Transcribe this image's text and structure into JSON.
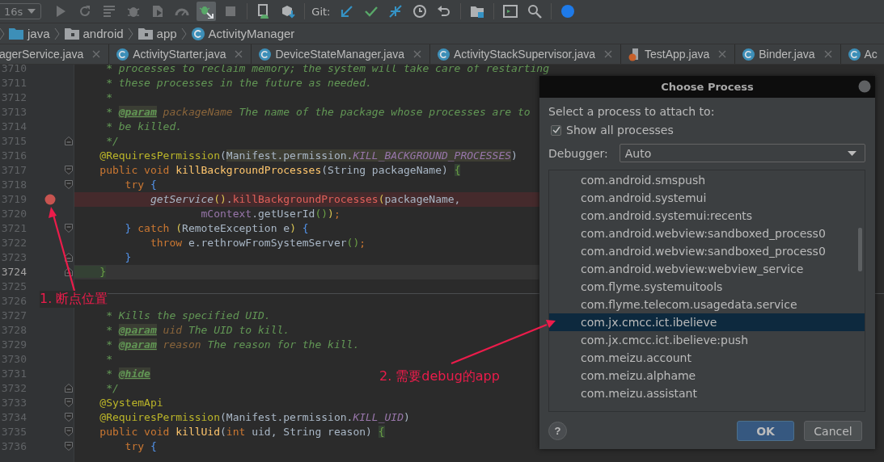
{
  "toolbar": {
    "config": "16s",
    "groups": [
      {
        "tools": [
          {
            "kind": "run",
            "disabled": true,
            "selected": false
          },
          {
            "kind": "rerun",
            "disabled": true,
            "selected": false
          },
          {
            "kind": "log",
            "disabled": true,
            "selected": false
          },
          {
            "kind": "debug",
            "disabled": true,
            "selected": false
          },
          {
            "kind": "coverage",
            "disabled": true,
            "selected": false
          },
          {
            "kind": "profile",
            "disabled": true,
            "selected": false
          },
          {
            "kind": "attach",
            "disabled": false,
            "selected": true
          },
          {
            "kind": "stop",
            "disabled": true,
            "selected": false
          }
        ]
      },
      {
        "tools": [
          {
            "kind": "device",
            "disabled": false,
            "selected": false
          },
          {
            "kind": "sdk",
            "disabled": false,
            "selected": false
          }
        ]
      },
      {
        "label": "Git:",
        "tools": [
          {
            "kind": "update",
            "disabled": false,
            "selected": false
          },
          {
            "kind": "commit",
            "disabled": false,
            "selected": false
          },
          {
            "kind": "compare",
            "disabled": false,
            "selected": false
          },
          {
            "kind": "history",
            "disabled": false,
            "selected": false
          },
          {
            "kind": "revert",
            "disabled": false,
            "selected": false
          }
        ]
      },
      {
        "tools": [
          {
            "kind": "folder",
            "disabled": false,
            "selected": false
          }
        ]
      },
      {
        "tools": [
          {
            "kind": "terminal",
            "disabled": false,
            "selected": false
          },
          {
            "kind": "search",
            "disabled": false,
            "selected": false
          }
        ]
      },
      {
        "tools": [
          {
            "kind": "sphere",
            "disabled": false,
            "selected": false
          }
        ]
      }
    ]
  },
  "breadcrumb": [
    {
      "kind": "source",
      "label": "java"
    },
    {
      "kind": "folder",
      "label": "android"
    },
    {
      "kind": "folder",
      "label": "app"
    },
    {
      "kind": "class",
      "label": "ActivityManager"
    }
  ],
  "tabs": [
    {
      "kind": "plain",
      "label": "agerService.java",
      "close": true
    },
    {
      "kind": "class",
      "label": "ActivityStarter.java",
      "close": true
    },
    {
      "kind": "class",
      "label": "DeviceStateManager.java",
      "close": true
    },
    {
      "kind": "class",
      "label": "ActivityStackSupervisor.java",
      "close": true
    },
    {
      "kind": "test",
      "label": "TestApp.java",
      "close": true
    },
    {
      "kind": "class",
      "label": "Binder.java",
      "close": true
    },
    {
      "kind": "class",
      "label": "Ac",
      "close": false
    }
  ],
  "lines": [
    {
      "number": "3710",
      "tokens": [
        {
          "kind": "comment",
          "text": "     * processes to reclaim memory; the system will take care of restarting"
        }
      ]
    },
    {
      "number": "3711",
      "tokens": [
        {
          "kind": "comment",
          "text": "     * these processes in the future as needed."
        }
      ]
    },
    {
      "number": "3712",
      "tokens": [
        {
          "kind": "comment",
          "text": "     *"
        }
      ]
    },
    {
      "number": "3713",
      "tokens": [
        {
          "kind": "comment",
          "text": "     * "
        },
        {
          "kind": "doctag",
          "text": "@param"
        },
        {
          "kind": "pname",
          "text": " packageName"
        },
        {
          "kind": "comment",
          "text": " The name of the package whose processes are to"
        }
      ]
    },
    {
      "number": "3714",
      "tokens": [
        {
          "kind": "comment",
          "text": "     * be killed."
        }
      ]
    },
    {
      "number": "3715",
      "fold_end": true,
      "tokens": [
        {
          "kind": "comment",
          "text": "     */"
        }
      ]
    },
    {
      "number": "3716",
      "tokens": [
        {
          "kind": "ann",
          "text": "    @RequiresPermission"
        },
        {
          "kind": "plain",
          "text": "("
        },
        {
          "kind": "hlplain",
          "text": "Manifest.permission."
        },
        {
          "kind": "hlconst",
          "text": "KILL_BACKGROUND_PROCESSES"
        },
        {
          "kind": "plain",
          "text": ")"
        }
      ]
    },
    {
      "number": "3717",
      "fold_start": true,
      "tokens": [
        {
          "kind": "kw",
          "text": "    public void "
        },
        {
          "kind": "fn",
          "text": "killBackgroundProcesses"
        },
        {
          "kind": "plain",
          "text": "(String packageName) "
        },
        {
          "kind": "gbrace",
          "text": "{"
        }
      ]
    },
    {
      "number": "3718",
      "fold_start": true,
      "tokens": [
        {
          "kind": "kw",
          "text": "        try "
        },
        {
          "kind": "bbrace",
          "text": "{"
        }
      ]
    },
    {
      "number": "3719",
      "breakpoint": true,
      "tokens": [
        {
          "kind": "static",
          "text": "            getService"
        },
        {
          "kind": "paren",
          "text": "()"
        },
        {
          "kind": "plain",
          "text": "."
        },
        {
          "kind": "call",
          "text": "killBackgroundProcesses"
        },
        {
          "kind": "paren",
          "text": "("
        },
        {
          "kind": "plain",
          "text": "packageName,"
        }
      ]
    },
    {
      "number": "3720",
      "tokens": [
        {
          "kind": "field",
          "text": "                    mContext"
        },
        {
          "kind": "plain",
          "text": ".getUserId"
        },
        {
          "kind": "gparen",
          "text": "()"
        },
        {
          "kind": "paren",
          "text": ")"
        },
        {
          "kind": "kw",
          "text": ";"
        }
      ]
    },
    {
      "number": "3721",
      "fold_start": true,
      "tokens": [
        {
          "kind": "bbrace",
          "text": "        }"
        },
        {
          "kind": "kw",
          "text": " catch "
        },
        {
          "kind": "paren",
          "text": "("
        },
        {
          "kind": "plain",
          "text": "RemoteException e"
        },
        {
          "kind": "paren",
          "text": ")"
        },
        {
          "kind": "bbrace",
          "text": " {"
        }
      ]
    },
    {
      "number": "3722",
      "tokens": [
        {
          "kind": "kw",
          "text": "            throw"
        },
        {
          "kind": "plain",
          "text": " e.rethrowFromSystemServer"
        },
        {
          "kind": "gparen",
          "text": "()"
        },
        {
          "kind": "kw",
          "text": ";"
        }
      ]
    },
    {
      "number": "3723",
      "fold_end": true,
      "tokens": [
        {
          "kind": "bbrace",
          "text": "        }"
        }
      ]
    },
    {
      "number": "3724",
      "fold_end": true,
      "current": true,
      "tokens": [
        {
          "kind": "gbrace",
          "text": "    }"
        }
      ]
    },
    {
      "number": "3725",
      "separator": true
    },
    {
      "number": "3726"
    },
    {
      "number": "3727",
      "tokens": [
        {
          "kind": "comment",
          "text": "     * Kills the specified UID."
        }
      ]
    },
    {
      "number": "3728",
      "tokens": [
        {
          "kind": "comment",
          "text": "     * "
        },
        {
          "kind": "doctag",
          "text": "@param"
        },
        {
          "kind": "pname",
          "text": " uid"
        },
        {
          "kind": "comment",
          "text": " The UID to kill."
        }
      ]
    },
    {
      "number": "3729",
      "tokens": [
        {
          "kind": "comment",
          "text": "     * "
        },
        {
          "kind": "doctag",
          "text": "@param"
        },
        {
          "kind": "pname",
          "text": " reason"
        },
        {
          "kind": "comment",
          "text": " The reason for the kill."
        }
      ]
    },
    {
      "number": "3730",
      "tokens": [
        {
          "kind": "comment",
          "text": "     *"
        }
      ]
    },
    {
      "number": "3731",
      "tokens": [
        {
          "kind": "comment",
          "text": "     * "
        },
        {
          "kind": "doctag",
          "text": "@hide"
        }
      ]
    },
    {
      "number": "3732",
      "fold_end": true,
      "tokens": [
        {
          "kind": "comment",
          "text": "     */"
        }
      ]
    },
    {
      "number": "3733",
      "fold_start": true,
      "tokens": [
        {
          "kind": "ann",
          "text": "    @SystemApi"
        }
      ]
    },
    {
      "number": "3734",
      "fold_start": true,
      "tokens": [
        {
          "kind": "ann",
          "text": "    @RequiresPermission"
        },
        {
          "kind": "plain",
          "text": "(Manifest.permission."
        },
        {
          "kind": "const",
          "text": "KILL_UID"
        },
        {
          "kind": "plain",
          "text": ")"
        }
      ]
    },
    {
      "number": "3735",
      "fold_start": true,
      "tokens": [
        {
          "kind": "kw",
          "text": "    public void "
        },
        {
          "kind": "fn",
          "text": "killUid"
        },
        {
          "kind": "plain",
          "text": "("
        },
        {
          "kind": "kw",
          "text": "int"
        },
        {
          "kind": "plain",
          "text": " uid, String reason) "
        },
        {
          "kind": "gbrace",
          "text": "{"
        }
      ]
    },
    {
      "number": "3736",
      "fold_start": true,
      "tokens": [
        {
          "kind": "kw",
          "text": "        try "
        },
        {
          "kind": "bbrace",
          "text": "{"
        }
      ]
    }
  ],
  "dialog": {
    "title": "Choose Process",
    "prompt": "Select a process to attach to:",
    "show_all": {
      "label": "Show all processes",
      "checked": true
    },
    "debugger": {
      "label": "Debugger:",
      "value": "Auto"
    },
    "processes": [
      {
        "name": "com.android.smspush",
        "selected": false
      },
      {
        "name": "com.android.systemui",
        "selected": false
      },
      {
        "name": "com.android.systemui:recents",
        "selected": false
      },
      {
        "name": "com.android.webview:sandboxed_process0",
        "selected": false
      },
      {
        "name": "com.android.webview:sandboxed_process0",
        "selected": false
      },
      {
        "name": "com.android.webview:webview_service",
        "selected": false
      },
      {
        "name": "com.flyme.systemuitools",
        "selected": false
      },
      {
        "name": "com.flyme.telecom.usagedata.service",
        "selected": false
      },
      {
        "name": "com.jx.cmcc.ict.ibelieve",
        "selected": true
      },
      {
        "name": "com.jx.cmcc.ict.ibelieve:push",
        "selected": false
      },
      {
        "name": "com.meizu.account",
        "selected": false
      },
      {
        "name": "com.meizu.alphame",
        "selected": false
      },
      {
        "name": "com.meizu.assistant",
        "selected": false
      }
    ],
    "help": "?",
    "buttons": [
      {
        "kind": "primary",
        "label": "OK"
      },
      {
        "kind": "secondary",
        "label": "Cancel"
      }
    ]
  },
  "annotations": [
    {
      "label": "1. 断点位置"
    },
    {
      "label": "2. 需要debug的app"
    }
  ]
}
